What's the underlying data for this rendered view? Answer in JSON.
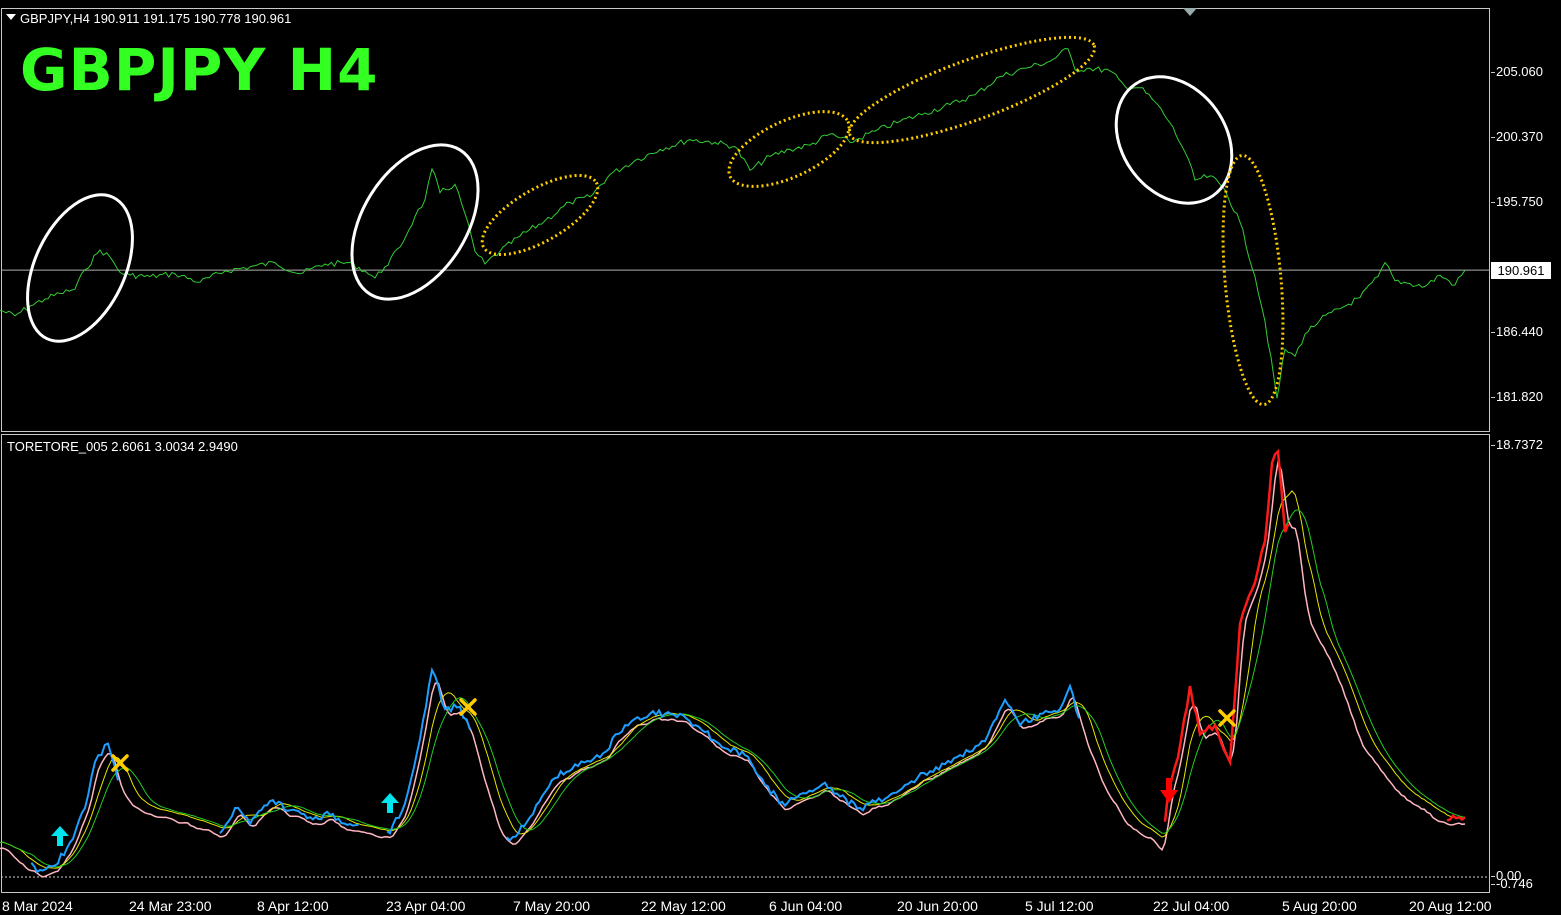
{
  "price_pane": {
    "header": "GBPJPY,H4  190.911 191.175 190.778 190.961",
    "big_title": "GBPJPY  H4",
    "current_price": "190.961",
    "ticks": [
      "205.060",
      "200.370",
      "195.750",
      "186.440",
      "181.820"
    ]
  },
  "indicator_pane": {
    "header": "TORETORE_005 2.6061 3.0034 2.9490",
    "max_label": "18.7372",
    "zero_label": "0.00",
    "min_label": "-0.746"
  },
  "time_axis": [
    "8 Mar 2024",
    "24 Mar 23:00",
    "8 Apr 12:00",
    "23 Apr 04:00",
    "7 May 20:00",
    "22 May 12:00",
    "6 Jun 04:00",
    "20 Jun 20:00",
    "5 Jul 12:00",
    "22 Jul 04:00",
    "5 Aug 20:00",
    "20 Aug 12:00"
  ],
  "colors": {
    "price_line": "#33cc33",
    "title": "#33ff22",
    "indicator_up": "#1e9fff",
    "indicator_down": "#ff1a1a",
    "fast_ma": "#ffb6c1",
    "slow_ma": "#22cc22",
    "mid_ma": "#e6e600",
    "up_arrow": "#00e5ee",
    "down_arrow": "#ff0000",
    "exit_mark": "#ffcc00",
    "ellipse_white": "#ffffff",
    "ellipse_yellow": "#ffcc00"
  },
  "chart_data": [
    {
      "type": "line",
      "series": [
        {
          "values": [
            [
              0,
              188.1
            ],
            [
              15,
              187.7
            ],
            [
              30,
              188.4
            ],
            [
              45,
              188.9
            ],
            [
              60,
              189.3
            ],
            [
              75,
              189.6
            ],
            [
              85,
              191.0
            ],
            [
              100,
              192.4
            ],
            [
              110,
              191.9
            ],
            [
              120,
              190.8
            ],
            [
              130,
              190.6
            ],
            [
              150,
              190.5
            ],
            [
              175,
              190.7
            ],
            [
              200,
              190.1
            ],
            [
              225,
              190.9
            ],
            [
              250,
              191.2
            ],
            [
              275,
              191.5
            ],
            [
              300,
              190.7
            ],
            [
              325,
              191.4
            ],
            [
              350,
              191.5
            ],
            [
              365,
              190.9
            ],
            [
              375,
              190.4
            ],
            [
              385,
              191.2
            ],
            [
              400,
              192.6
            ],
            [
              415,
              194.8
            ],
            [
              425,
              196.0
            ],
            [
              432,
              198.2
            ],
            [
              440,
              196.5
            ],
            [
              455,
              197.1
            ],
            [
              465,
              195.0
            ],
            [
              475,
              192.3
            ],
            [
              485,
              191.4
            ],
            [
              500,
              192.3
            ],
            [
              520,
              193.4
            ],
            [
              545,
              194.5
            ],
            [
              570,
              195.8
            ],
            [
              590,
              196.2
            ],
            [
              610,
              197.8
            ],
            [
              635,
              198.8
            ],
            [
              660,
              199.6
            ],
            [
              690,
              200.3
            ],
            [
              715,
              200.1
            ],
            [
              735,
              199.8
            ],
            [
              750,
              198.1
            ],
            [
              770,
              199.1
            ],
            [
              790,
              199.6
            ],
            [
              810,
              199.9
            ],
            [
              830,
              200.7
            ],
            [
              850,
              200.1
            ],
            [
              875,
              200.9
            ],
            [
              900,
              201.6
            ],
            [
              925,
              202.2
            ],
            [
              950,
              202.8
            ],
            [
              975,
              203.5
            ],
            [
              1000,
              204.8
            ],
            [
              1025,
              205.4
            ],
            [
              1050,
              205.9
            ],
            [
              1068,
              206.8
            ],
            [
              1075,
              205.3
            ],
            [
              1090,
              205.4
            ],
            [
              1110,
              205.2
            ],
            [
              1125,
              204.1
            ],
            [
              1140,
              204.0
            ],
            [
              1155,
              203.0
            ],
            [
              1170,
              201.5
            ],
            [
              1185,
              199.4
            ],
            [
              1195,
              197.4
            ],
            [
              1210,
              197.7
            ],
            [
              1225,
              196.7
            ],
            [
              1240,
              194.4
            ],
            [
              1255,
              190.5
            ],
            [
              1265,
              187.3
            ],
            [
              1277,
              181.8
            ],
            [
              1285,
              185.3
            ],
            [
              1295,
              184.8
            ],
            [
              1305,
              186.4
            ],
            [
              1320,
              187.4
            ],
            [
              1340,
              188.2
            ],
            [
              1360,
              189.0
            ],
            [
              1378,
              190.5
            ],
            [
              1385,
              191.5
            ],
            [
              1395,
              190.2
            ],
            [
              1410,
              190.0
            ],
            [
              1425,
              189.8
            ],
            [
              1440,
              190.6
            ],
            [
              1455,
              189.9
            ],
            [
              1465,
              190.96
            ]
          ]
        }
      ]
    },
    {
      "type": "line",
      "series": [
        {
          "values": [
            [
              0,
              1.5
            ],
            [
              20,
              0.8
            ],
            [
              40,
              0.3
            ],
            [
              55,
              0.5
            ],
            [
              70,
              1.5
            ],
            [
              85,
              3.0
            ],
            [
              95,
              5.0
            ],
            [
              108,
              5.8
            ],
            [
              118,
              4.2
            ],
            [
              130,
              3.3
            ],
            [
              160,
              2.9
            ],
            [
              200,
              2.3
            ],
            [
              220,
              1.9
            ],
            [
              235,
              3.0
            ],
            [
              250,
              2.3
            ],
            [
              270,
              3.3
            ],
            [
              290,
              2.9
            ],
            [
              310,
              2.6
            ],
            [
              330,
              2.7
            ],
            [
              350,
              2.3
            ],
            [
              370,
              2.1
            ],
            [
              390,
              1.9
            ],
            [
              405,
              3.2
            ],
            [
              420,
              6.0
            ],
            [
              432,
              9.0
            ],
            [
              445,
              7.3
            ],
            [
              460,
              7.4
            ],
            [
              470,
              6.4
            ],
            [
              485,
              4.0
            ],
            [
              500,
              2.0
            ],
            [
              510,
              1.6
            ],
            [
              530,
              2.6
            ],
            [
              555,
              4.3
            ],
            [
              575,
              4.9
            ],
            [
              600,
              5.2
            ],
            [
              625,
              6.6
            ],
            [
              650,
              7.1
            ],
            [
              680,
              7.1
            ],
            [
              705,
              6.3
            ],
            [
              725,
              5.6
            ],
            [
              745,
              5.3
            ],
            [
              765,
              4.0
            ],
            [
              785,
              3.1
            ],
            [
              800,
              3.6
            ],
            [
              825,
              4.1
            ],
            [
              840,
              3.5
            ],
            [
              860,
              3.0
            ],
            [
              885,
              3.4
            ],
            [
              905,
              4.0
            ],
            [
              930,
              4.6
            ],
            [
              960,
              5.3
            ],
            [
              985,
              5.9
            ],
            [
              1005,
              7.7
            ],
            [
              1020,
              6.6
            ],
            [
              1040,
              7.1
            ],
            [
              1060,
              7.3
            ],
            [
              1070,
              8.3
            ],
            [
              1085,
              6.0
            ],
            [
              1105,
              3.9
            ],
            [
              1125,
              2.6
            ],
            [
              1145,
              2.0
            ],
            [
              1162,
              1.4
            ],
            [
              1168,
              3.6
            ],
            [
              1178,
              5.2
            ],
            [
              1190,
              8.3
            ],
            [
              1200,
              6.2
            ],
            [
              1215,
              6.6
            ],
            [
              1230,
              5.0
            ],
            [
              1240,
              11.0
            ],
            [
              1255,
              12.8
            ],
            [
              1265,
              14.6
            ],
            [
              1272,
              18.0
            ],
            [
              1278,
              18.5
            ],
            [
              1285,
              15.0
            ],
            [
              1292,
              16.0
            ],
            [
              1305,
              11.5
            ],
            [
              1330,
              9.5
            ],
            [
              1360,
              6.0
            ],
            [
              1390,
              4.2
            ],
            [
              1410,
              3.5
            ],
            [
              1430,
              2.9
            ],
            [
              1450,
              2.5
            ],
            [
              1465,
              2.6
            ]
          ]
        }
      ]
    }
  ]
}
